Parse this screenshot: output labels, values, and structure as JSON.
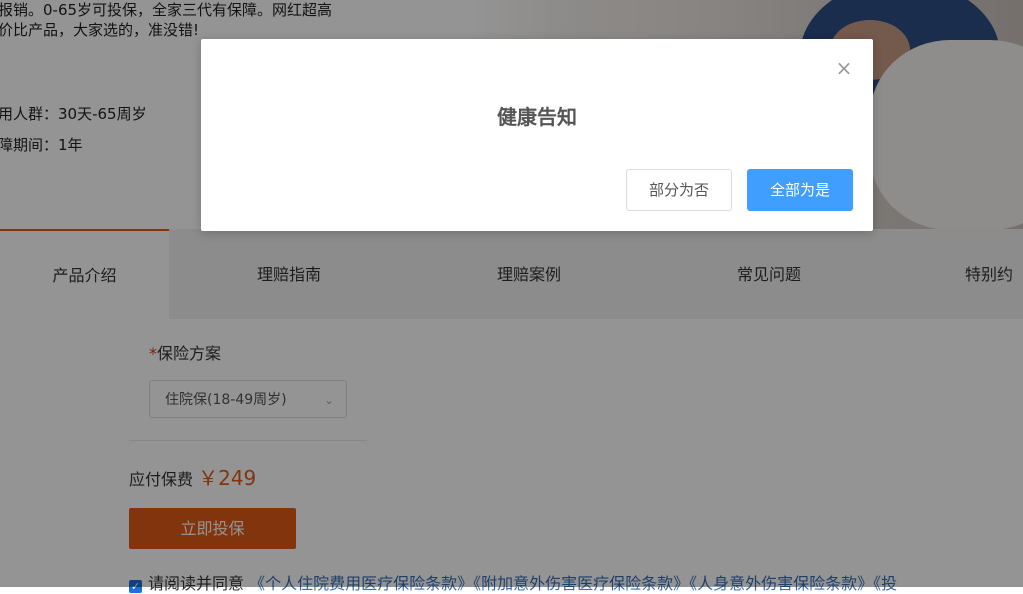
{
  "hero": {
    "desc_line1": "报销。0-65岁可投保，全家三代有保障。网红超高",
    "desc_line2": "价比产品，大家选的，准没错!",
    "crowd": "用人群：30天-65周岁",
    "period": "障期间：1年"
  },
  "tabs": [
    {
      "label": "产品介绍",
      "active": true
    },
    {
      "label": "理赔指南"
    },
    {
      "label": "理赔案例"
    },
    {
      "label": "常见问题"
    },
    {
      "label": "特别约"
    }
  ],
  "plan": {
    "required_mark": "*",
    "label": "保险方案",
    "selected": "住院保(18-49周岁)"
  },
  "premium": {
    "label": "应付保费",
    "amount": "￥249"
  },
  "buy_label": "立即投保",
  "agreement": {
    "prefix": "请阅读并同意",
    "links": "《个人住院费用医疗保险条款》《附加意外伤害医疗保险条款》《人身意外伤害保险条款》《投"
  },
  "modal": {
    "title": "健康告知",
    "no_label": "部分为否",
    "yes_label": "全部为是"
  },
  "colors": {
    "accent_orange": "#e05a17",
    "primary_blue": "#409eff",
    "link_blue": "#3a6fb5"
  }
}
